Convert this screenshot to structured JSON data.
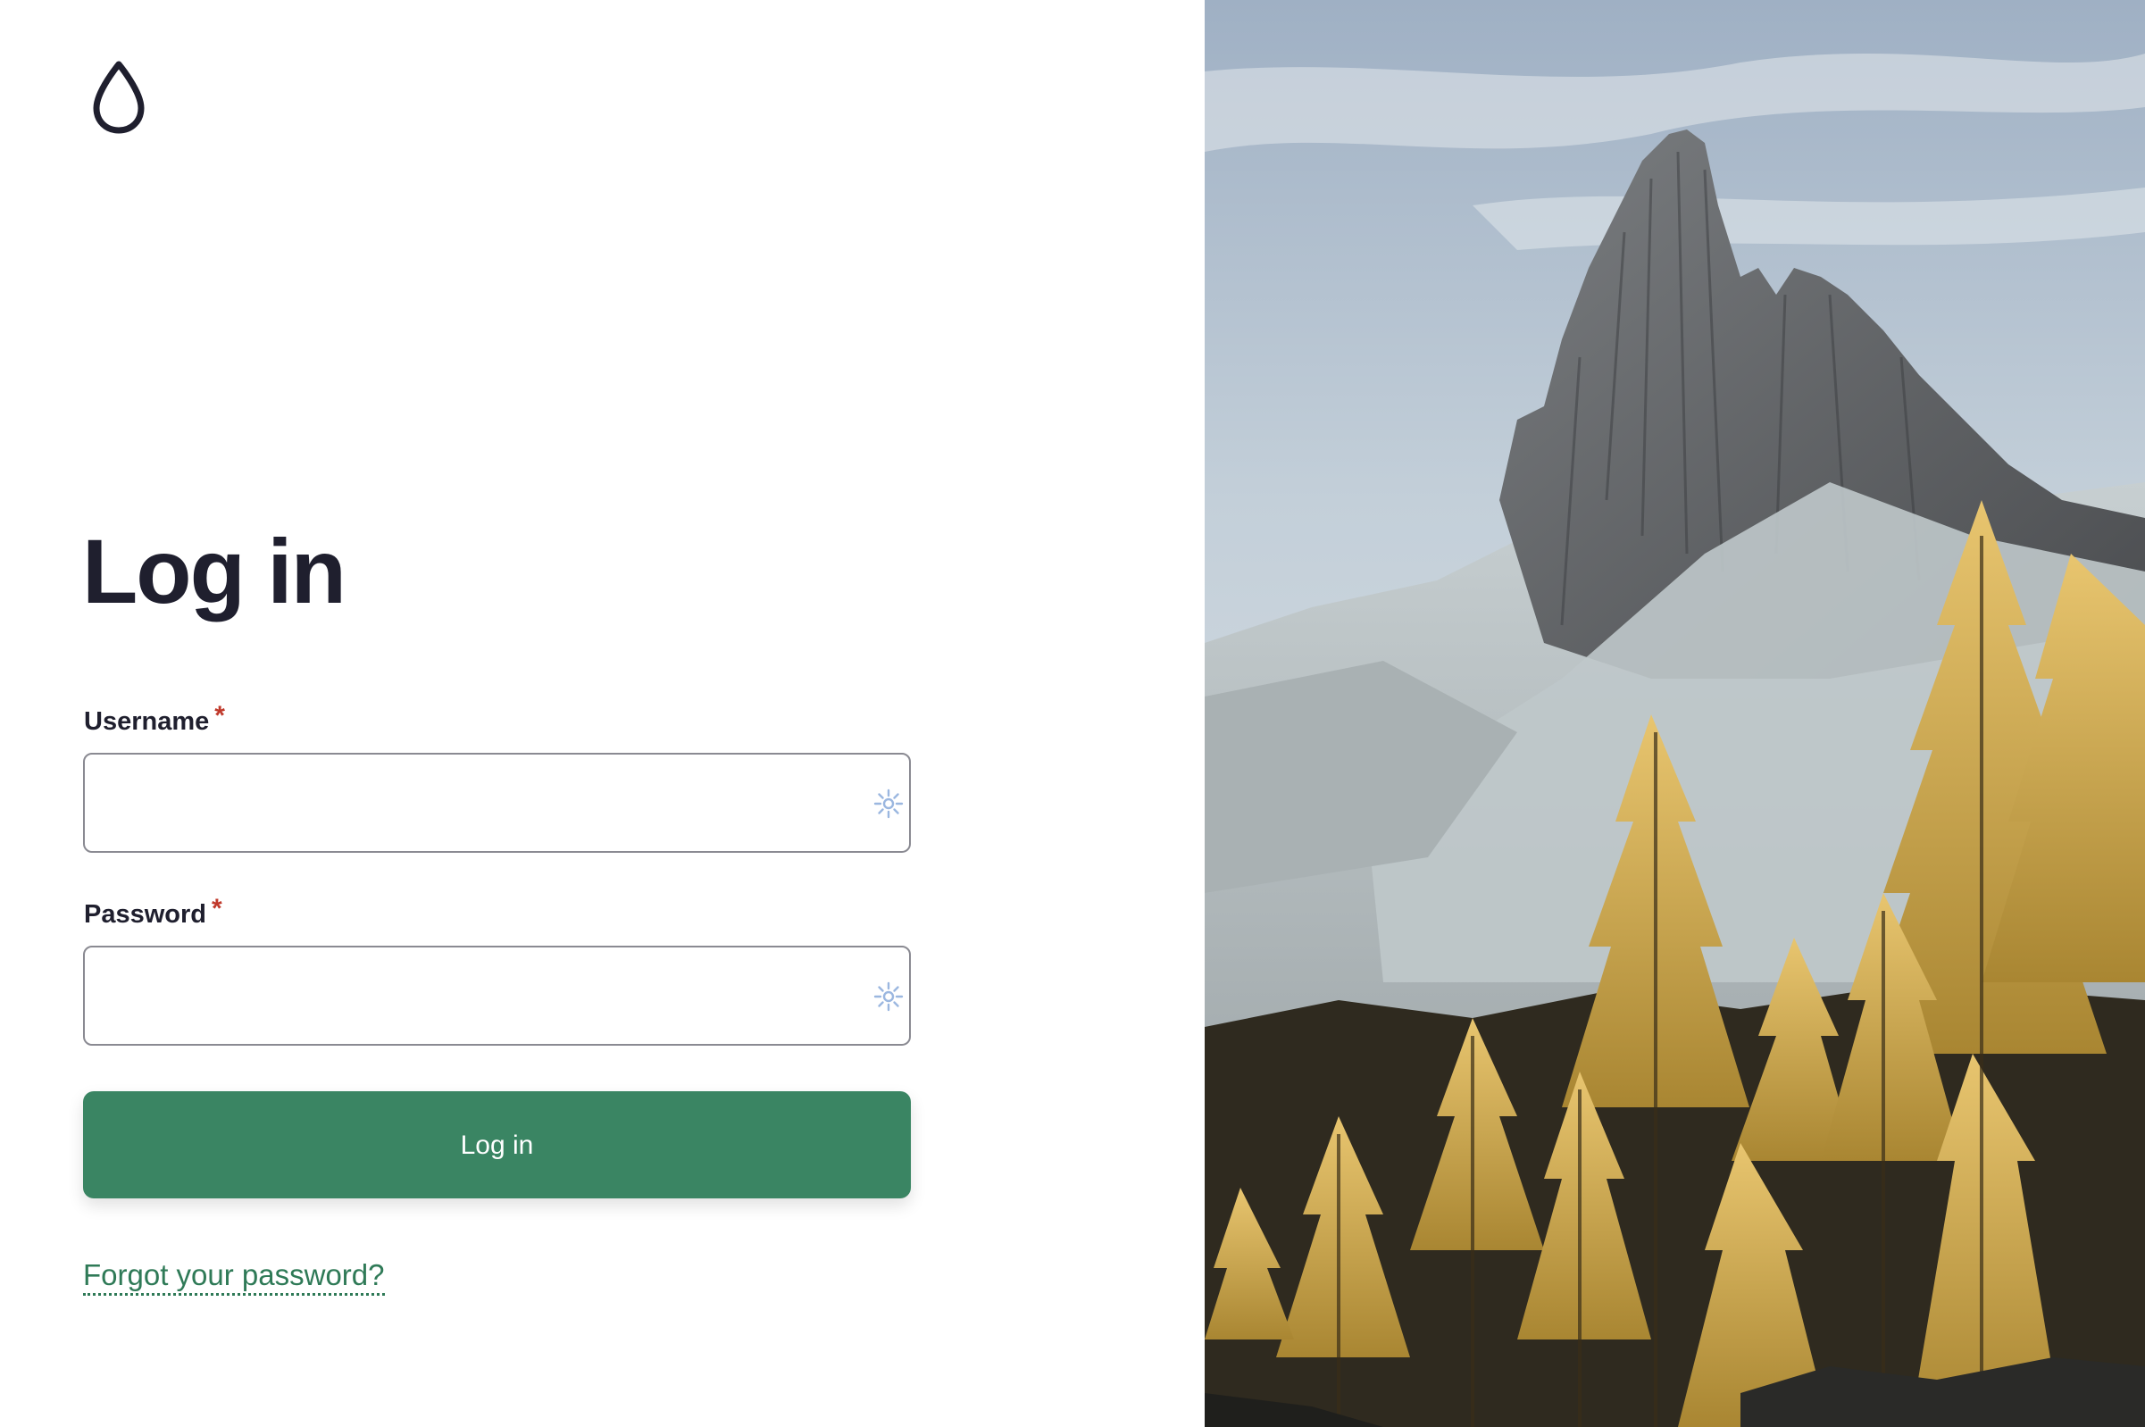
{
  "page": {
    "title": "Log in"
  },
  "logo": {
    "icon": "droplet-logo-icon"
  },
  "form": {
    "username": {
      "label": "Username",
      "required_mark": "*",
      "value": "",
      "placeholder": "",
      "icon": "password-manager-key-icon"
    },
    "password": {
      "label": "Password",
      "required_mark": "*",
      "value": "",
      "placeholder": "",
      "icon": "password-manager-key-icon"
    },
    "submit_label": "Log in",
    "forgot_link": "Forgot your password?"
  },
  "hero_image": {
    "subject": "mountain-peak-with-golden-larch-trees"
  },
  "colors": {
    "accent": "#3a8563",
    "link": "#2f7a57",
    "text": "#1f1f2e",
    "required": "#c0392b",
    "input_border": "#8a8a92"
  }
}
